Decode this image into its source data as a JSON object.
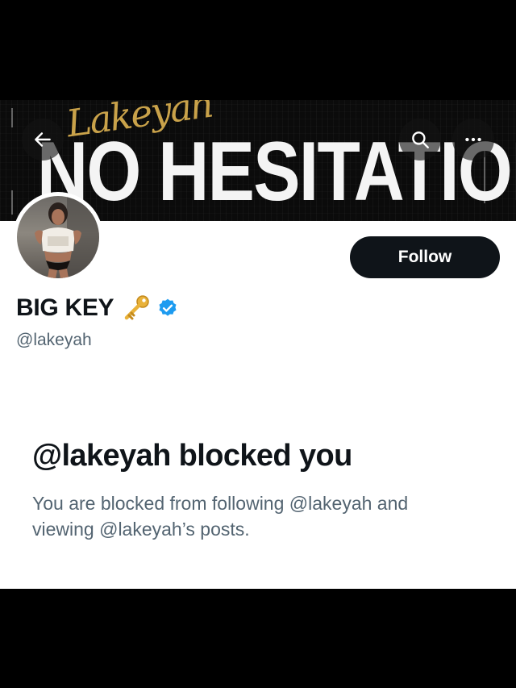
{
  "banner": {
    "headline": "NO HESITATION",
    "script_text": "Lakeyah"
  },
  "nav": {
    "back_icon": "arrow-left-icon",
    "search_icon": "search-icon",
    "more_icon": "more-horizontal-icon"
  },
  "profile": {
    "display_name": "BIG KEY",
    "emoji": "key-icon",
    "verified": true,
    "verified_color": "#1d9bf0",
    "handle": "@lakeyah",
    "follow_label": "Follow",
    "follow_button_color": "#0f1419"
  },
  "blocked": {
    "title": "@lakeyah blocked you",
    "description": "You are blocked from following @lakeyah and viewing @lakeyah’s posts."
  }
}
